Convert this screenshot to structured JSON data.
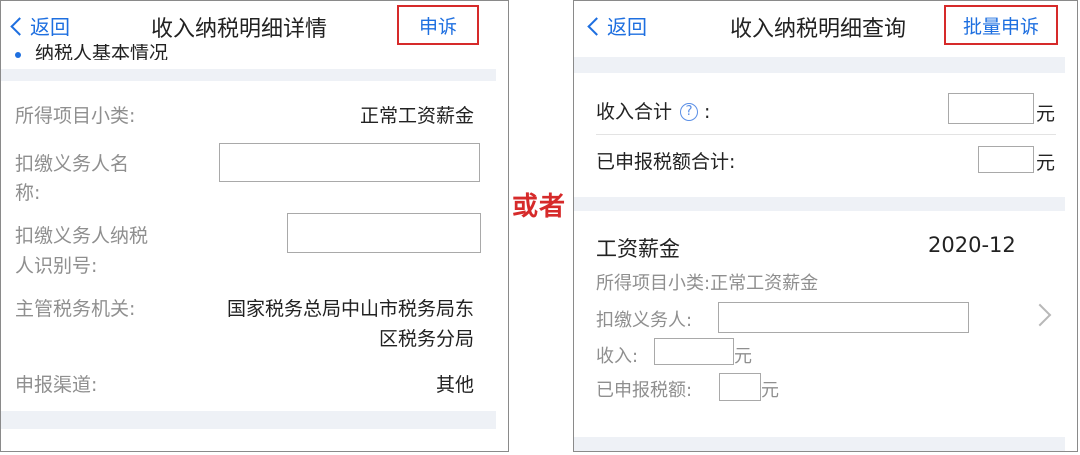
{
  "left": {
    "back_label": "返回",
    "title": "收入纳税明细详情",
    "action_label": "申诉",
    "section_header_partial": "纳税人基本情况",
    "rows": [
      {
        "label": "所得项目小类:",
        "value": "正常工资薪金"
      },
      {
        "label_line1": "扣缴义务人名",
        "label_line2": "称:",
        "value": ""
      },
      {
        "label_line1": "扣缴义务人纳税",
        "label_line2": "人识别号:",
        "value": ""
      },
      {
        "label": "主管税务机关:",
        "value_line1": "国家税务总局中山市税务局东",
        "value_line2": "区税务分局"
      },
      {
        "label": "申报渠道:",
        "value": "其他"
      }
    ]
  },
  "middle_label": "或者",
  "right": {
    "back_label": "返回",
    "title": "收入纳税明细查询",
    "action_label": "批量申诉",
    "income_total_label": "收入合计",
    "help_glyph": "?",
    "colon": ":",
    "declared_tax_total_label": "已申报税额合计:",
    "currency": "元",
    "record": {
      "title": "工资薪金",
      "date": "2020-12",
      "subcategory_label": "所得项目小类:",
      "subcategory_value": "正常工资薪金",
      "withholder_label": "扣缴义务人:",
      "income_label": "收入:",
      "declared_tax_label": "已申报税额:"
    }
  },
  "colors": {
    "accent": "#1e6fe0",
    "highlight": "#d62a2a",
    "separator": "#eef1f6"
  }
}
